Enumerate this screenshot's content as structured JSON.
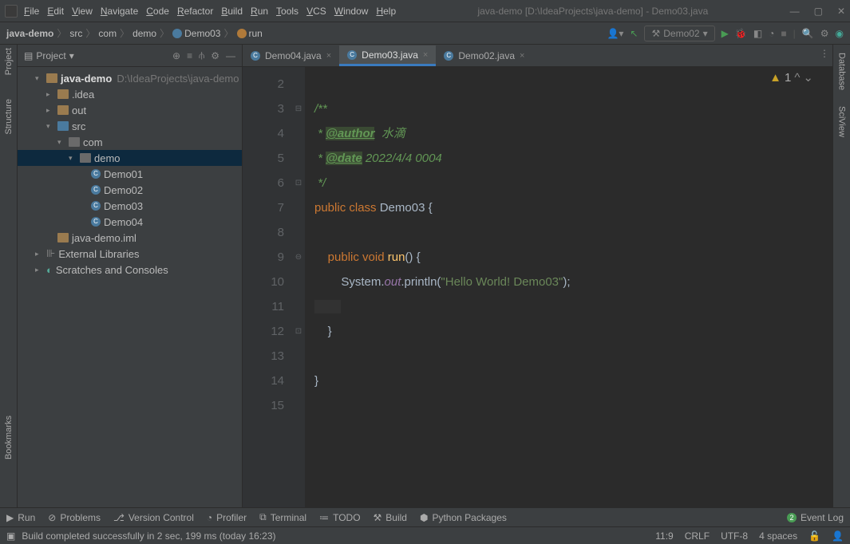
{
  "title": "java-demo [D:\\IdeaProjects\\java-demo] - Demo03.java",
  "menu": [
    "File",
    "Edit",
    "View",
    "Navigate",
    "Code",
    "Refactor",
    "Build",
    "Run",
    "Tools",
    "VCS",
    "Window",
    "Help"
  ],
  "breadcrumbs": {
    "items": [
      "java-demo",
      "src",
      "com",
      "demo",
      "Demo03",
      "run"
    ]
  },
  "run_config": "Demo02",
  "project": {
    "title": "Project",
    "root": {
      "name": "java-demo",
      "path": "D:\\IdeaProjects\\java-demo"
    },
    "tree": [
      {
        "d": 1,
        "chev": "▾",
        "ico": "fo",
        "name": "java-demo",
        "dim": "D:\\IdeaProjects\\java-demo",
        "bold": true
      },
      {
        "d": 2,
        "chev": "▸",
        "ico": "fo",
        "name": ".idea"
      },
      {
        "d": 2,
        "chev": "▸",
        "ico": "fo",
        "name": "out"
      },
      {
        "d": 2,
        "chev": "▾",
        "ico": "fo blue",
        "name": "src"
      },
      {
        "d": 3,
        "chev": "▾",
        "ico": "fo grey",
        "name": "com"
      },
      {
        "d": 4,
        "chev": "▾",
        "ico": "fo grey",
        "name": "demo",
        "sel": true
      },
      {
        "d": 5,
        "chev": "",
        "ico": "fc",
        "name": "Demo01"
      },
      {
        "d": 5,
        "chev": "",
        "ico": "fc",
        "name": "Demo02"
      },
      {
        "d": 5,
        "chev": "",
        "ico": "fc",
        "name": "Demo03"
      },
      {
        "d": 5,
        "chev": "",
        "ico": "fc",
        "name": "Demo04"
      },
      {
        "d": 2,
        "chev": "",
        "ico": "fo",
        "name": "java-demo.iml"
      },
      {
        "d": 1,
        "chev": "▸",
        "ico": "lib",
        "name": "External Libraries"
      },
      {
        "d": 1,
        "chev": "▸",
        "ico": "scr",
        "name": "Scratches and Consoles"
      }
    ]
  },
  "left_stripe": [
    "Project",
    "Structure",
    "Bookmarks"
  ],
  "right_stripe": [
    "Database",
    "SciView"
  ],
  "tabs": [
    {
      "label": "Demo04.java",
      "active": false
    },
    {
      "label": "Demo03.java",
      "active": true
    },
    {
      "label": "Demo02.java",
      "active": false
    }
  ],
  "line_start": 2,
  "line_end": 15,
  "code_html": "\n<span class='c-comment'>/**</span>\n<span class='c-comment'> * </span><span class='c-tag'>@author</span><span class='c-comment'>  水滴</span>\n<span class='c-comment'> * </span><span class='c-tag'>@date</span><span class='c-comment'> 2022/4/4 0004</span>\n<span class='c-comment'> */</span>\n<span class='c-kw'>public class</span> <span class='c-cls'>Demo03</span> <span class='c-txt'>{</span>\n\n    <span class='c-kw'>public void</span> <span class='c-meth'>run</span><span class='c-txt'>() {</span>\n        <span class='c-txt'>System.</span><span class='c-field'>out</span><span class='c-txt'>.println(</span><span class='c-str'>\"Hello World! Demo03\"</span><span class='c-txt'>);</span>\n<span class='caret-line'>        </span>\n    <span class='c-txt'>}</span>\n\n<span class='c-txt'>}</span>\n",
  "warnings": "1",
  "bottom": [
    "Run",
    "Problems",
    "Version Control",
    "Profiler",
    "Terminal",
    "TODO",
    "Build",
    "Python Packages"
  ],
  "event_count": "2",
  "event_label": "Event Log",
  "status": {
    "msg": "Build completed successfully in 2 sec, 199 ms (today 16:23)",
    "pos": "11:9",
    "le": "CRLF",
    "enc": "UTF-8",
    "indent": "4 spaces"
  }
}
